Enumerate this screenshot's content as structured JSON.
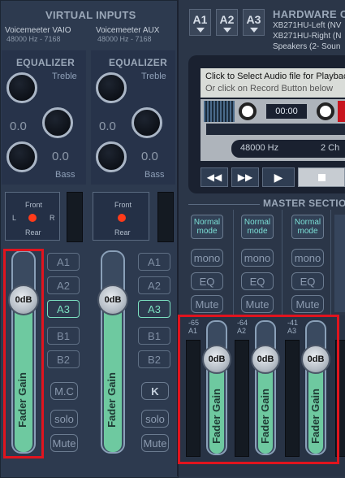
{
  "virtual_inputs": {
    "title": "VIRTUAL INPUTS",
    "strips": [
      {
        "name": "Voicemeeter VAIO",
        "format": "48000 Hz - 7168",
        "eq_title": "EQUALIZER",
        "treble_label": "Treble",
        "bass_label": "Bass",
        "treble_value": "0.0",
        "bass_value": "0.0",
        "pan_front": "Front",
        "pan_rear": "Rear",
        "pan_left": "L",
        "pan_right": "R",
        "buses": [
          "A1",
          "A2",
          "A3",
          "B1",
          "B2"
        ],
        "active_bus": "A3",
        "gain": "0dB",
        "fader_label": "Fader Gain",
        "mode_label": "M.C",
        "solo_label": "solo",
        "mute_label": "Mute"
      },
      {
        "name": "Voicemeeter AUX",
        "format": "48000 Hz - 7168",
        "eq_title": "EQUALIZER",
        "treble_label": "Treble",
        "bass_label": "Bass",
        "treble_value": "0.0",
        "bass_value": "0.0",
        "pan_front": "Front",
        "pan_rear": "Rear",
        "buses": [
          "A1",
          "A2",
          "A3",
          "B1",
          "B2"
        ],
        "active_bus": "A3",
        "gain": "0dB",
        "fader_label": "Fader Gain",
        "mode_label": "K",
        "solo_label": "solo",
        "mute_label": "Mute"
      }
    ]
  },
  "hardware_out": {
    "buttons": [
      "A1",
      "A2",
      "A3"
    ],
    "title": "HARDWARE OU",
    "devices": [
      "XB271HU-Left (NV",
      "XB271HU-Right (N",
      "Speakers (2- Soun"
    ]
  },
  "recorder": {
    "line1": "Click to Select Audio file for Playback",
    "line2": "Or click on Record Button below",
    "time": "00:00",
    "sample_rate": "48000 Hz",
    "channels": "2 Ch"
  },
  "master_section": {
    "title": "MASTER SECTIO",
    "strips": [
      {
        "mode_line1": "Normal",
        "mode_line2": "mode",
        "mono": "mono",
        "eq": "EQ",
        "mute": "Mute",
        "level": "-65",
        "bus": "A1",
        "gain": "0dB",
        "fader_label": "Fader Gain"
      },
      {
        "mode_line1": "Normal",
        "mode_line2": "mode",
        "mono": "mono",
        "eq": "EQ",
        "mute": "Mute",
        "level": "-64",
        "bus": "A2",
        "gain": "0dB",
        "fader_label": "Fader Gain"
      },
      {
        "mode_line1": "Normal",
        "mode_line2": "mode",
        "mono": "mono",
        "eq": "EQ",
        "mute": "Mute",
        "level": "-41",
        "bus": "A3",
        "gain": "0dB",
        "fader_label": "Fader Gain"
      }
    ]
  },
  "colors": {
    "fader_fill": "#6ec9a0",
    "active_bus": "#7be0c0",
    "highlight_box": "#e0141e",
    "background": "#2b3648"
  }
}
